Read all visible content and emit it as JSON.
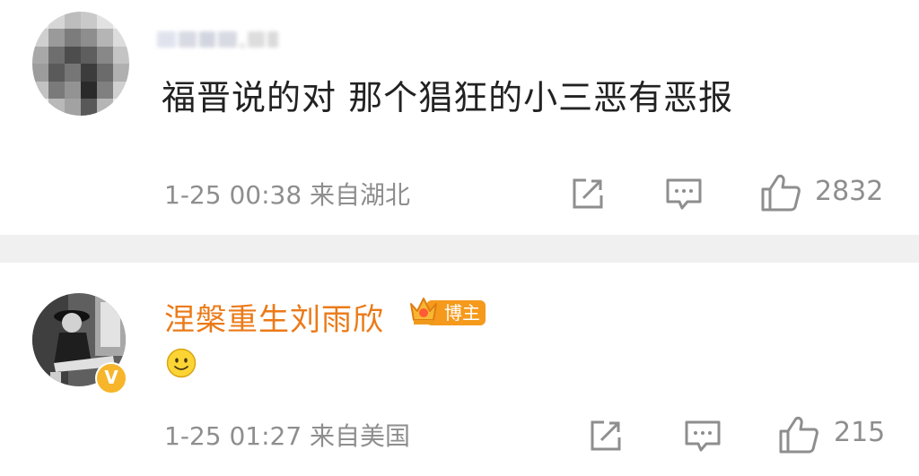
{
  "comments": [
    {
      "username": "",
      "text": "福晋说的对 那个猖狂的小三恶有恶报",
      "time": "1-25 00:38",
      "location": "来自湖北",
      "likes": "2832",
      "avatar_icon": "pixelated-avatar"
    },
    {
      "username": "涅槃重生刘雨欣",
      "badge": "博主",
      "verified_mark": "V",
      "text": "🙂",
      "time": "1-25 01:27",
      "location": "来自美国",
      "likes": "215",
      "avatar_icon": "photo-avatar"
    }
  ],
  "colors": {
    "username_orange": "#eb7a18",
    "badge_orange": "#f59a1c",
    "meta_gray": "#8e8e8e",
    "divider_gray": "#f0f0f0",
    "verified_gold": "#f6b52a"
  },
  "icons": [
    "share-icon",
    "comment-icon",
    "like-icon",
    "crown-icon",
    "smile-emoji-icon"
  ]
}
